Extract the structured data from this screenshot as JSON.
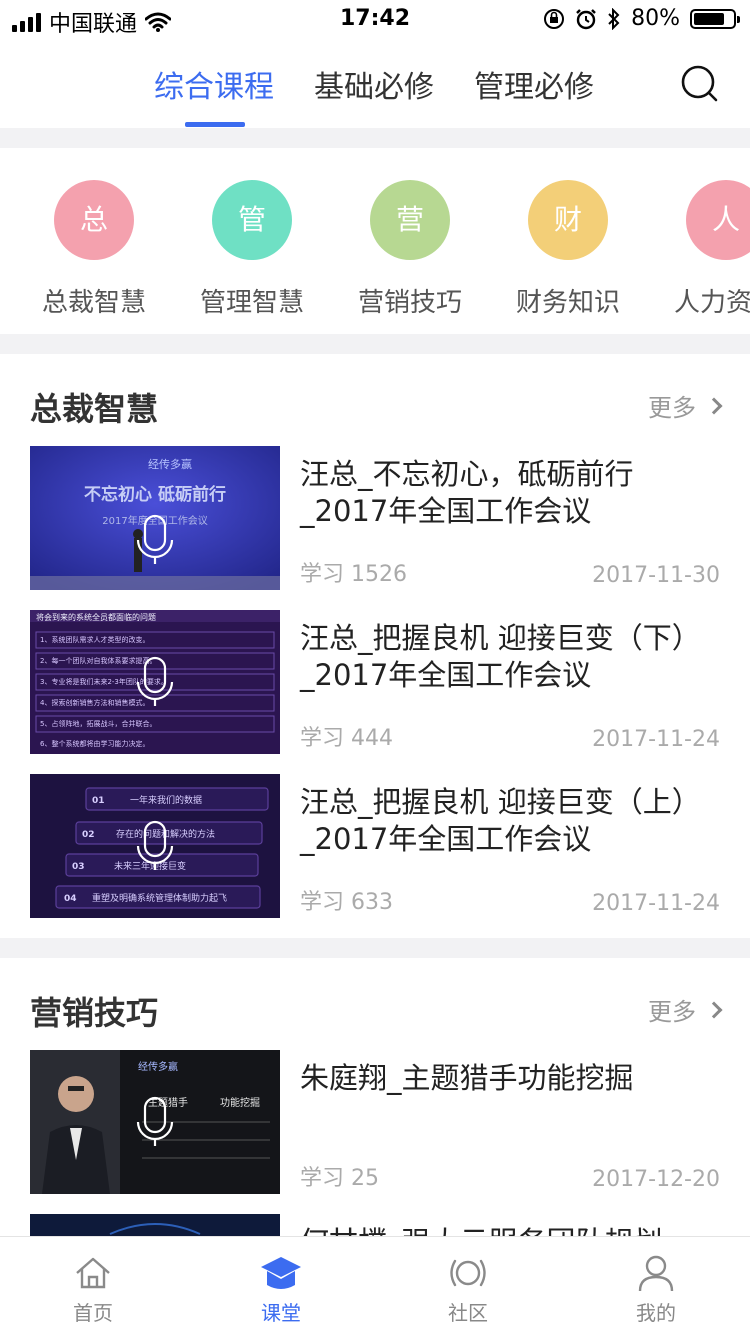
{
  "status": {
    "carrier": "中国联通",
    "time": "17:42",
    "battery": "80%",
    "battery_level": 0.8
  },
  "top_tabs": [
    {
      "label": "综合课程",
      "active": true
    },
    {
      "label": "基础必修",
      "active": false
    },
    {
      "label": "管理必修",
      "active": false
    }
  ],
  "categories": [
    {
      "glyph": "总",
      "label": "总裁智慧",
      "color": "#f4a1ae"
    },
    {
      "glyph": "管",
      "label": "管理智慧",
      "color": "#6fe0c4"
    },
    {
      "glyph": "营",
      "label": "营销技巧",
      "color": "#b7d892"
    },
    {
      "glyph": "财",
      "label": "财务知识",
      "color": "#f3cf78"
    },
    {
      "glyph": "人",
      "label": "人力资源",
      "color": "#f4a1ae"
    }
  ],
  "sections": [
    {
      "title": "总裁智慧",
      "more": "更多",
      "items": [
        {
          "title": "汪总_不忘初心，砥砺前行_2017年全国工作会议",
          "study": "学习 1526",
          "date": "2017-11-30",
          "thumb_lines": [
            "经传多赢",
            "不忘初心 砥砺前行",
            "2017年度全国工作会议"
          ]
        },
        {
          "title": "汪总_把握良机 迎接巨变（下）_2017年全国工作会议",
          "study": "学习 444",
          "date": "2017-11-24",
          "thumb_lines": [
            "将会到来的系统全员都面临的问题",
            "1、系统团队需求人才类型的改变。",
            "2、每一个团队对自我体系要求提高。",
            "3、专业将是我们未来2-3年团队的要求。",
            "4、探索创新销售方法和销售模式。",
            "5、占领阵地，拓展战斗，合并联合。",
            "6、整个系统都将由学习能力决定。"
          ]
        },
        {
          "title": "汪总_把握良机 迎接巨变（上）_2017年全国工作会议",
          "study": "学习 633",
          "date": "2017-11-24",
          "thumb_lines": [
            "01",
            "一年来我们的数据",
            "02",
            "存在的问题和解决的方法",
            "03",
            "未来三年迎接巨变",
            "04",
            "重塑及明确系统管理体制助力起飞"
          ]
        }
      ]
    },
    {
      "title": "营销技巧",
      "more": "更多",
      "items": [
        {
          "title": "朱庭翔_主题猎手功能挖掘",
          "study": "学习 25",
          "date": "2017-12-20",
          "thumb_lines": [
            "经传多赢",
            "主题猎手",
            "功能挖掘"
          ]
        },
        {
          "title": "何甘樸_强大云服务团队规划",
          "study": "",
          "date": "",
          "thumb_lines": []
        }
      ]
    }
  ],
  "nav": [
    {
      "label": "首页",
      "icon": "home-icon",
      "active": false
    },
    {
      "label": "课堂",
      "icon": "graduation-cap-icon",
      "active": true
    },
    {
      "label": "社区",
      "icon": "community-icon",
      "active": false
    },
    {
      "label": "我的",
      "icon": "profile-icon",
      "active": false
    }
  ],
  "colors": {
    "accent": "#3c6cf0"
  }
}
